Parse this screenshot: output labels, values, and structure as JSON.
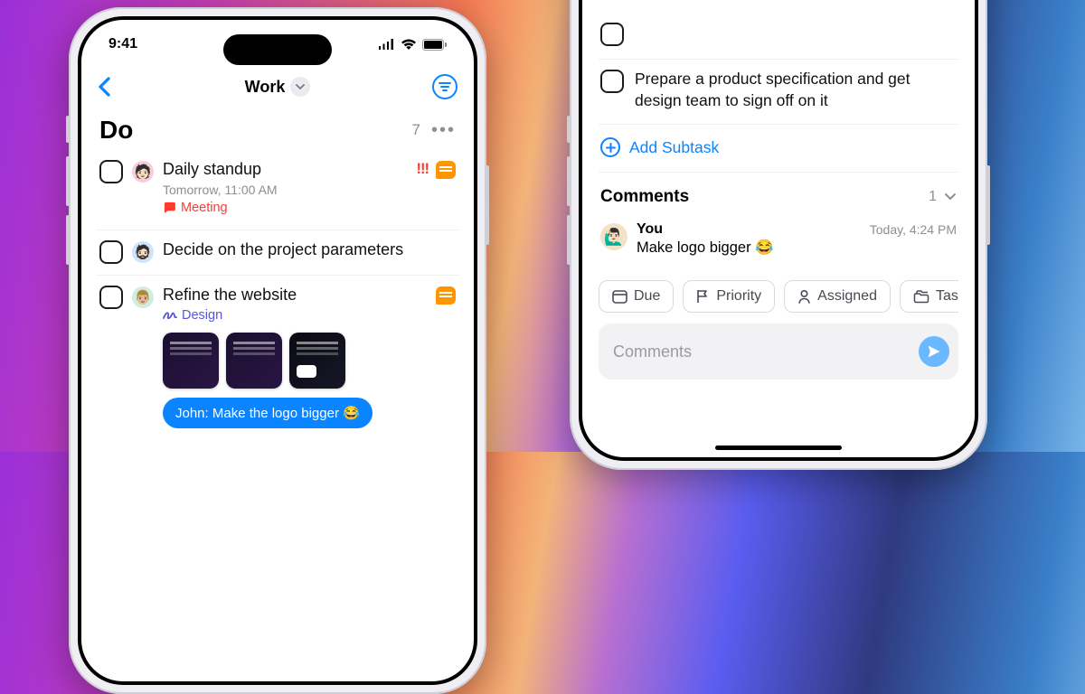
{
  "status": {
    "time": "9:41"
  },
  "nav": {
    "title": "Work"
  },
  "list": {
    "header": "Do",
    "count": "7",
    "tasks": [
      {
        "title": "Daily standup",
        "sub": "Tomorrow, 11:00 AM",
        "tag": "Meeting",
        "priority": "!!!",
        "avatar_bg": "av-pink",
        "avatar_emoji": "🧑🏻",
        "has_chat": true
      },
      {
        "title": "Decide on the project parameters",
        "avatar_bg": "av-blue",
        "avatar_emoji": "🧔🏻"
      },
      {
        "title": "Refine the website",
        "design_tag": "Design",
        "avatar_bg": "av-green",
        "avatar_emoji": "👨🏼",
        "has_chat": true,
        "show_thumbs": true,
        "message": "John: Make the logo bigger 😂"
      }
    ]
  },
  "detail": {
    "subtask": "Prepare a product specification and get design team to sign off on it",
    "add_subtask_label": "Add Subtask",
    "comments_header": "Comments",
    "comments_count": "1",
    "comment": {
      "author": "You",
      "time": "Today, 4:24 PM",
      "text": "Make logo bigger 😂",
      "avatar_emoji": "🙋🏻‍♂️"
    },
    "chips": {
      "due": "Due",
      "priority": "Priority",
      "assigned": "Assigned",
      "type": "Task Type"
    },
    "composer_placeholder": "Comments"
  }
}
